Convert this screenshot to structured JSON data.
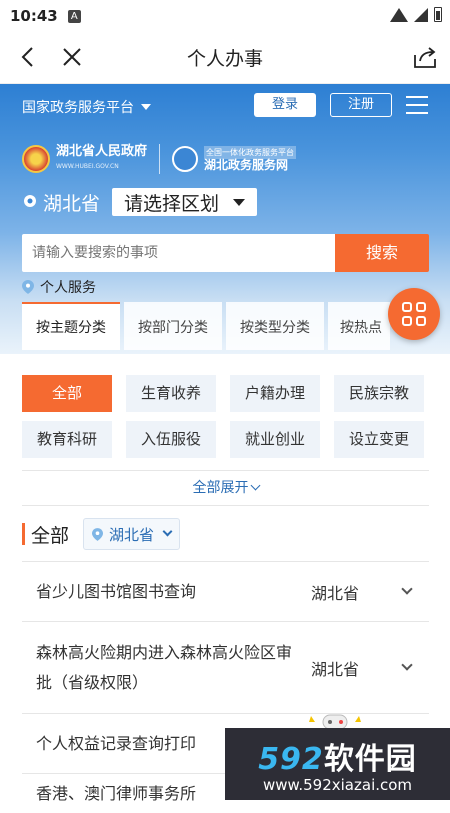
{
  "status": {
    "time": "10:43",
    "notif_icon": "A"
  },
  "nav": {
    "title": "个人办事"
  },
  "topbar": {
    "platform": "国家政务服务平台",
    "login": "登录",
    "register": "注册"
  },
  "logos": {
    "gov_name": "湖北省人民政府",
    "gov_url": "WWW.HUBEI.GOV.CN",
    "svc_sub": "全国一体化政务服务平台",
    "svc_name": "湖北政务服务网"
  },
  "region": {
    "province": "湖北省",
    "select_label": "请选择区划"
  },
  "search": {
    "placeholder": "请输入要搜索的事项",
    "button": "搜索"
  },
  "personal_label": "个人服务",
  "tabs": [
    "按主题分类",
    "按部门分类",
    "按类型分类",
    "按热点"
  ],
  "categories": [
    "全部",
    "生育收养",
    "户籍办理",
    "民族宗教",
    "教育科研",
    "入伍服役",
    "就业创业",
    "设立变更"
  ],
  "expand_label": "全部展开",
  "section": {
    "label": "全部",
    "location": "湖北省"
  },
  "items": [
    {
      "name": "省少儿图书馆图书查询",
      "prov": "湖北省"
    },
    {
      "name": "森林高火险期内进入森林高火险区审批（省级权限）",
      "prov": "湖北省"
    },
    {
      "name": "个人权益记录查询打印",
      "prov": ""
    },
    {
      "name": "香港、澳门律师事务所",
      "prov": ""
    }
  ],
  "watermark": {
    "num": "592",
    "brand": "软件园",
    "url": "www.592xiazai.com"
  },
  "colors": {
    "accent": "#f56a31",
    "primary": "#2b6db4",
    "header_blue": "#2d7fd3"
  }
}
